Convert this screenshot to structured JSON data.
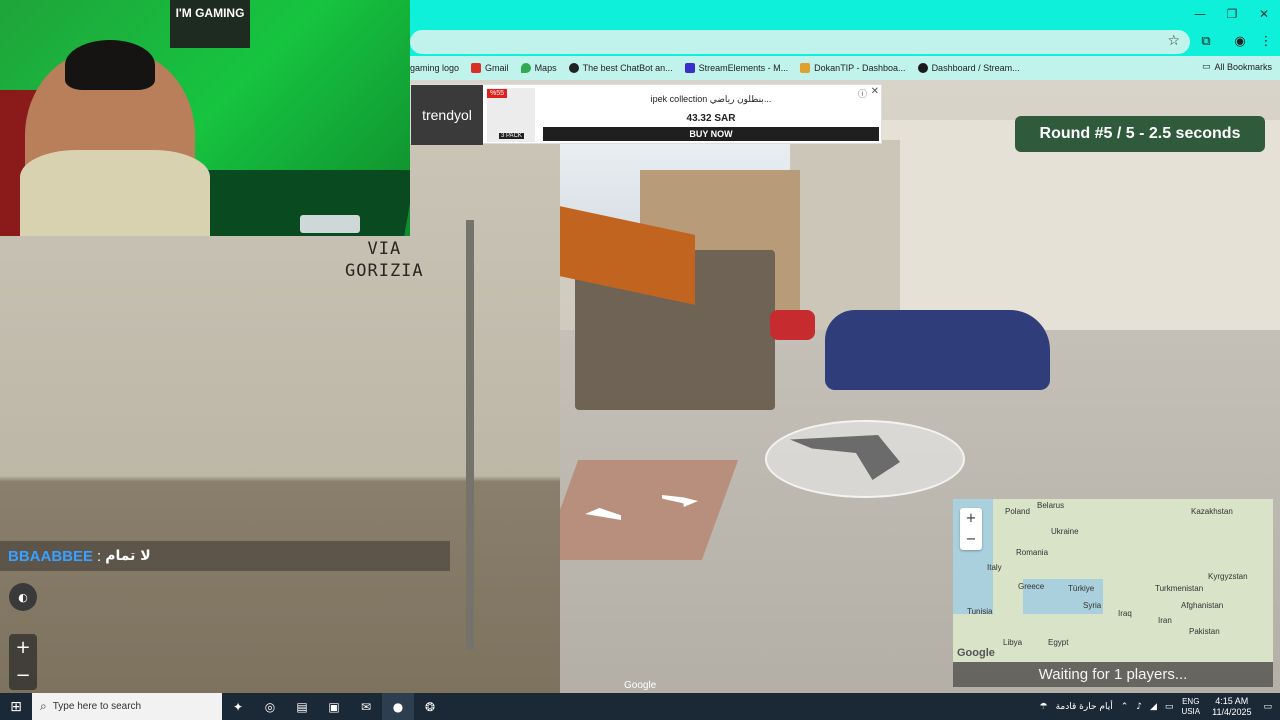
{
  "browser": {
    "window_controls": {
      "minimize": "—",
      "restore": "❐",
      "close": "✕"
    },
    "star_icon": "☆",
    "toolbar_icons": [
      "extensions-icon",
      "profile-icon",
      "menu-icon"
    ],
    "bookmarks": [
      {
        "label": "gaming logo",
        "color": "#cccccc"
      },
      {
        "label": "Gmail",
        "color": "#d93025"
      },
      {
        "label": "Maps",
        "color": "#34a853"
      },
      {
        "label": "The best ChatBot an...",
        "color": "#202124"
      },
      {
        "label": "StreamElements - M...",
        "color": "#3b2fc9"
      },
      {
        "label": "DokanTIP - Dashboa...",
        "color": "#e0a030"
      },
      {
        "label": "Dashboard / Stream...",
        "color": "#1a1a1a"
      }
    ],
    "all_bookmarks": "All Bookmarks"
  },
  "game": {
    "round_status": "Round #5 / 5 - 2.5 seconds",
    "sign_text_line1": "VIA",
    "sign_text_line2": "GORIZIA",
    "google_watermark": "Google",
    "waiting": "Waiting for 1 players..."
  },
  "ad": {
    "brand": "trendyol",
    "badge": "%55",
    "sub": "3 PACK",
    "title": "ipek collection بنطلون رياضي...",
    "price": "43.32 SAR",
    "cta": "BUY NOW",
    "info_icon": "ⓘ",
    "close_icon": "✕"
  },
  "webcam": {
    "sign": "I'M GAMING"
  },
  "chat": {
    "user": "BBAABBEE",
    "separator": ":",
    "message": "لا تمام"
  },
  "controls": {
    "zoom_in": "+",
    "zoom_out": "−"
  },
  "minimap": {
    "labels": [
      "Poland",
      "Belarus",
      "Ukraine",
      "Kazakhstan",
      "Romania",
      "Italy",
      "Greece",
      "Türkiye",
      "Turkmenistan",
      "Kyrgyzstan",
      "Tunisia",
      "Syria",
      "Iraq",
      "Iran",
      "Afghanistan",
      "Pakistan",
      "Libya",
      "Egypt"
    ],
    "google_logo": "Google",
    "zoom_in": "+",
    "zoom_out": "−"
  },
  "taskbar": {
    "start_icon": "⊞",
    "search_placeholder": "Type here to search",
    "weather_text": "أيام حارة قادمة",
    "lang_line1": "ENG",
    "lang_line2": "USIA",
    "time": "4:15 AM",
    "date": "11/4/2025"
  }
}
